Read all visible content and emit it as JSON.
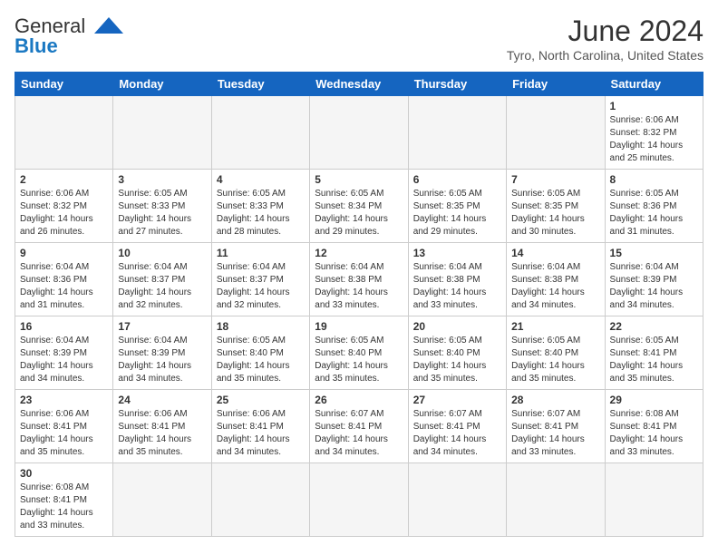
{
  "header": {
    "logo_general": "General",
    "logo_blue": "Blue",
    "month_title": "June 2024",
    "location": "Tyro, North Carolina, United States"
  },
  "weekdays": [
    "Sunday",
    "Monday",
    "Tuesday",
    "Wednesday",
    "Thursday",
    "Friday",
    "Saturday"
  ],
  "weeks": [
    [
      {
        "day": "",
        "info": ""
      },
      {
        "day": "",
        "info": ""
      },
      {
        "day": "",
        "info": ""
      },
      {
        "day": "",
        "info": ""
      },
      {
        "day": "",
        "info": ""
      },
      {
        "day": "",
        "info": ""
      },
      {
        "day": "1",
        "info": "Sunrise: 6:06 AM\nSunset: 8:32 PM\nDaylight: 14 hours and 25 minutes."
      }
    ],
    [
      {
        "day": "2",
        "info": "Sunrise: 6:06 AM\nSunset: 8:32 PM\nDaylight: 14 hours and 26 minutes."
      },
      {
        "day": "3",
        "info": "Sunrise: 6:05 AM\nSunset: 8:33 PM\nDaylight: 14 hours and 27 minutes."
      },
      {
        "day": "4",
        "info": "Sunrise: 6:05 AM\nSunset: 8:33 PM\nDaylight: 14 hours and 28 minutes."
      },
      {
        "day": "5",
        "info": "Sunrise: 6:05 AM\nSunset: 8:34 PM\nDaylight: 14 hours and 29 minutes."
      },
      {
        "day": "6",
        "info": "Sunrise: 6:05 AM\nSunset: 8:35 PM\nDaylight: 14 hours and 29 minutes."
      },
      {
        "day": "7",
        "info": "Sunrise: 6:05 AM\nSunset: 8:35 PM\nDaylight: 14 hours and 30 minutes."
      },
      {
        "day": "8",
        "info": "Sunrise: 6:05 AM\nSunset: 8:36 PM\nDaylight: 14 hours and 31 minutes."
      }
    ],
    [
      {
        "day": "9",
        "info": "Sunrise: 6:04 AM\nSunset: 8:36 PM\nDaylight: 14 hours and 31 minutes."
      },
      {
        "day": "10",
        "info": "Sunrise: 6:04 AM\nSunset: 8:37 PM\nDaylight: 14 hours and 32 minutes."
      },
      {
        "day": "11",
        "info": "Sunrise: 6:04 AM\nSunset: 8:37 PM\nDaylight: 14 hours and 32 minutes."
      },
      {
        "day": "12",
        "info": "Sunrise: 6:04 AM\nSunset: 8:38 PM\nDaylight: 14 hours and 33 minutes."
      },
      {
        "day": "13",
        "info": "Sunrise: 6:04 AM\nSunset: 8:38 PM\nDaylight: 14 hours and 33 minutes."
      },
      {
        "day": "14",
        "info": "Sunrise: 6:04 AM\nSunset: 8:38 PM\nDaylight: 14 hours and 34 minutes."
      },
      {
        "day": "15",
        "info": "Sunrise: 6:04 AM\nSunset: 8:39 PM\nDaylight: 14 hours and 34 minutes."
      }
    ],
    [
      {
        "day": "16",
        "info": "Sunrise: 6:04 AM\nSunset: 8:39 PM\nDaylight: 14 hours and 34 minutes."
      },
      {
        "day": "17",
        "info": "Sunrise: 6:04 AM\nSunset: 8:39 PM\nDaylight: 14 hours and 34 minutes."
      },
      {
        "day": "18",
        "info": "Sunrise: 6:05 AM\nSunset: 8:40 PM\nDaylight: 14 hours and 35 minutes."
      },
      {
        "day": "19",
        "info": "Sunrise: 6:05 AM\nSunset: 8:40 PM\nDaylight: 14 hours and 35 minutes."
      },
      {
        "day": "20",
        "info": "Sunrise: 6:05 AM\nSunset: 8:40 PM\nDaylight: 14 hours and 35 minutes."
      },
      {
        "day": "21",
        "info": "Sunrise: 6:05 AM\nSunset: 8:40 PM\nDaylight: 14 hours and 35 minutes."
      },
      {
        "day": "22",
        "info": "Sunrise: 6:05 AM\nSunset: 8:41 PM\nDaylight: 14 hours and 35 minutes."
      }
    ],
    [
      {
        "day": "23",
        "info": "Sunrise: 6:06 AM\nSunset: 8:41 PM\nDaylight: 14 hours and 35 minutes."
      },
      {
        "day": "24",
        "info": "Sunrise: 6:06 AM\nSunset: 8:41 PM\nDaylight: 14 hours and 35 minutes."
      },
      {
        "day": "25",
        "info": "Sunrise: 6:06 AM\nSunset: 8:41 PM\nDaylight: 14 hours and 34 minutes."
      },
      {
        "day": "26",
        "info": "Sunrise: 6:07 AM\nSunset: 8:41 PM\nDaylight: 14 hours and 34 minutes."
      },
      {
        "day": "27",
        "info": "Sunrise: 6:07 AM\nSunset: 8:41 PM\nDaylight: 14 hours and 34 minutes."
      },
      {
        "day": "28",
        "info": "Sunrise: 6:07 AM\nSunset: 8:41 PM\nDaylight: 14 hours and 33 minutes."
      },
      {
        "day": "29",
        "info": "Sunrise: 6:08 AM\nSunset: 8:41 PM\nDaylight: 14 hours and 33 minutes."
      }
    ],
    [
      {
        "day": "30",
        "info": "Sunrise: 6:08 AM\nSunset: 8:41 PM\nDaylight: 14 hours and 33 minutes."
      },
      {
        "day": "",
        "info": ""
      },
      {
        "day": "",
        "info": ""
      },
      {
        "day": "",
        "info": ""
      },
      {
        "day": "",
        "info": ""
      },
      {
        "day": "",
        "info": ""
      },
      {
        "day": "",
        "info": ""
      }
    ]
  ]
}
